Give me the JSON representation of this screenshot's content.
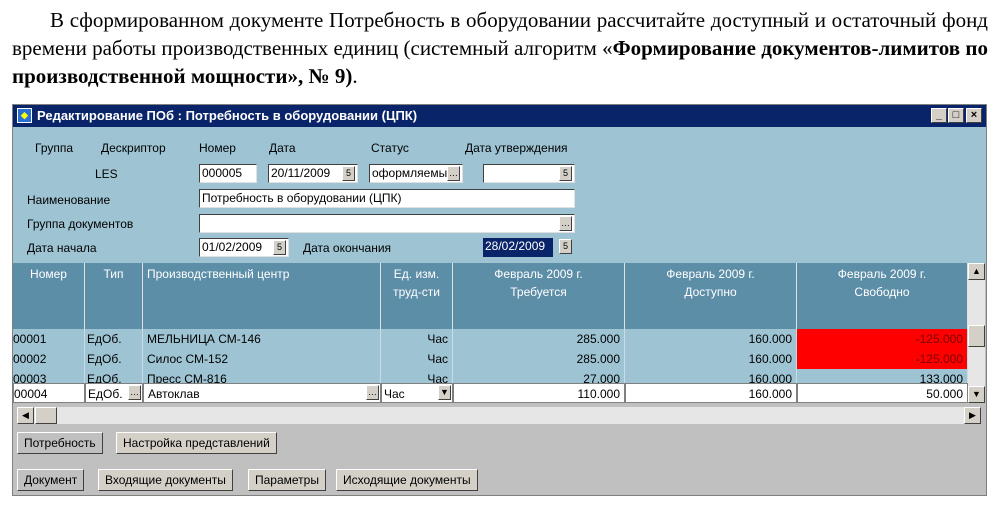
{
  "instruction": {
    "part1": "В сформированном документе Потребность в оборудовании рассчитайте доступный и остаточный фонд времени работы производственных единиц (системный алгоритм «",
    "bold": "Формирование документов-лимитов по производственной мощности», № 9)",
    "part2": "."
  },
  "window": {
    "title": "Редактирование ПОб : Потребность в оборудовании (ЦПК)",
    "buttons": {
      "minimize": "_",
      "maximize": "□",
      "close": "×"
    }
  },
  "form": {
    "labels": {
      "group": "Группа",
      "descriptor": "Дескриптор",
      "number": "Номер",
      "date": "Дата",
      "status": "Статус",
      "approval_date": "Дата утверждения",
      "name": "Наименование",
      "doc_group": "Группа документов",
      "start_date": "Дата начала",
      "end_date": "Дата окончания"
    },
    "descriptor_value": "LES",
    "number_value": "000005",
    "date_value": "20/11/2009",
    "status_value": "оформляемы",
    "approval_date_value": "",
    "name_value": "Потребность в оборудовании (ЦПК)",
    "doc_group_value": "",
    "start_date_value": "01/02/2009",
    "end_date_value": "28/02/2009"
  },
  "grid": {
    "headers": {
      "num": "Номер",
      "type": "Тип",
      "center": "Производственный центр",
      "unit1": "Ед. изм.",
      "unit2": "труд-сти",
      "req1": "Февраль 2009 г.",
      "req2": "Требуется",
      "avail1": "Февраль 2009 г.",
      "avail2": "Доступно",
      "free1": "Февраль 2009 г.",
      "free2": "Свободно"
    },
    "rows": [
      {
        "num": "00001",
        "type": "ЕдОб.",
        "center": "МЕЛЬНИЦА СМ-146",
        "unit": "Час",
        "required": "285.000",
        "available": "160.000",
        "free": "-125.000"
      },
      {
        "num": "00002",
        "type": "ЕдОб.",
        "center": "Силос СМ-152",
        "unit": "Час",
        "required": "285.000",
        "available": "160.000",
        "free": "-125.000"
      },
      {
        "num": "00003",
        "type": "ЕдОб.",
        "center": "Пресс СМ-816",
        "unit": "Час",
        "required": "27.000",
        "available": "160.000",
        "free": "133.000"
      },
      {
        "num": "00004",
        "type": "ЕдОб.",
        "center": "Автоклав",
        "unit": "Час",
        "required": "110.000",
        "available": "160.000",
        "free": "50.000"
      }
    ]
  },
  "tabs_top": [
    "Потребность",
    "Настройка представлений"
  ],
  "tabs_bottom": [
    "Документ",
    "Входящие документы",
    "Параметры",
    "Исходящие документы"
  ],
  "colors": {
    "title_bar": "#0a246a",
    "form_bg": "#9ec4d4",
    "header_bg": "#5d8ea8",
    "negative": "#ff0000"
  }
}
